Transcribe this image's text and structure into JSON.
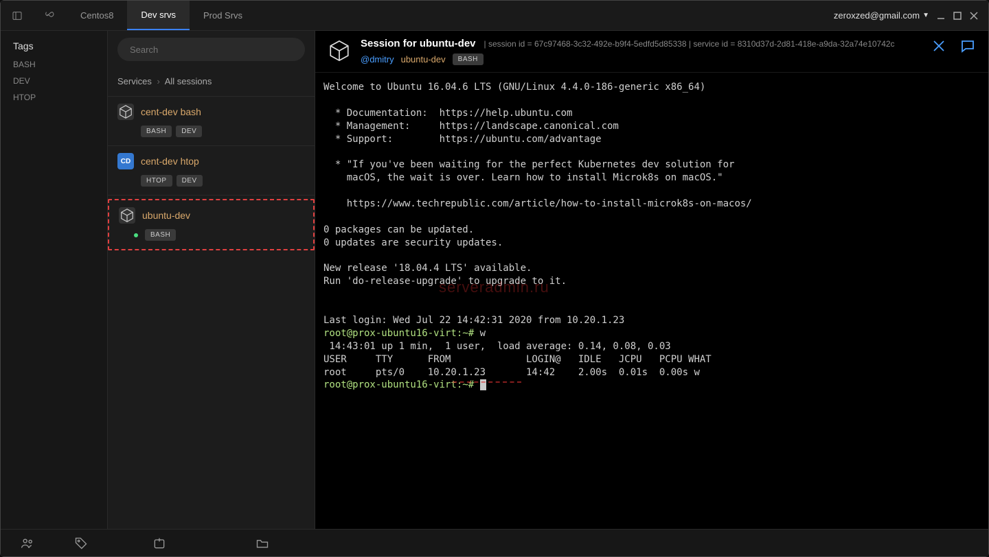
{
  "titlebar": {
    "tabs": [
      {
        "label": "Centos8",
        "active": false
      },
      {
        "label": "Dev srvs",
        "active": true
      },
      {
        "label": "Prod Srvs",
        "active": false
      }
    ],
    "user_email": "zeroxzed@gmail.com"
  },
  "sidebar": {
    "tags_header": "Tags",
    "tags": [
      "BASH",
      "DEV",
      "HTOP"
    ]
  },
  "mid": {
    "search_placeholder": "Search",
    "breadcrumb": {
      "a": "Services",
      "b": "All sessions"
    },
    "services": [
      {
        "icon": "cube",
        "name": "cent-dev bash",
        "badges": [
          "BASH",
          "DEV"
        ],
        "selected": false,
        "running": false
      },
      {
        "icon": "cd",
        "name": "cent-dev htop",
        "badges": [
          "HTOP",
          "DEV"
        ],
        "selected": false,
        "running": false
      },
      {
        "icon": "cube",
        "name": "ubuntu-dev",
        "badges": [
          "BASH"
        ],
        "selected": true,
        "running": true
      }
    ]
  },
  "session_header": {
    "title": "Session for ubuntu-dev",
    "session_id_label": "session id = 67c97468-3c32-492e-b9f4-5edfd5d85338",
    "service_id_label": "service id = 8310d37d-2d81-418e-a9da-32a74e10742c",
    "user": "@dmitry",
    "host": "ubuntu-dev",
    "badge": "BASH"
  },
  "terminal": {
    "lines": [
      "Welcome to Ubuntu 16.04.6 LTS (GNU/Linux 4.4.0-186-generic x86_64)",
      "",
      "  * Documentation:  https://help.ubuntu.com",
      "  * Management:     https://landscape.canonical.com",
      "  * Support:        https://ubuntu.com/advantage",
      "",
      "  * \"If you've been waiting for the perfect Kubernetes dev solution for",
      "    macOS, the wait is over. Learn how to install Microk8s on macOS.\"",
      "",
      "    https://www.techrepublic.com/article/how-to-install-microk8s-on-macos/",
      "",
      "0 packages can be updated.",
      "0 updates are security updates.",
      "",
      "New release '18.04.4 LTS' available.",
      "Run 'do-release-upgrade' to upgrade to it.",
      "",
      "",
      "Last login: Wed Jul 22 14:42:31 2020 from 10.20.1.23"
    ],
    "prompt1": "root@prox-ubuntu16-virt:~# ",
    "cmd1": "w",
    "w_output": [
      " 14:43:01 up 1 min,  1 user,  load average: 0.14, 0.08, 0.03",
      "USER     TTY      FROM             LOGIN@   IDLE   JCPU   PCPU WHAT",
      "root     pts/0    10.20.1.23       14:42    2.00s  0.01s  0.00s w"
    ],
    "prompt2": "root@prox-ubuntu16-virt:~# "
  },
  "watermark": "serveradmin.ru"
}
